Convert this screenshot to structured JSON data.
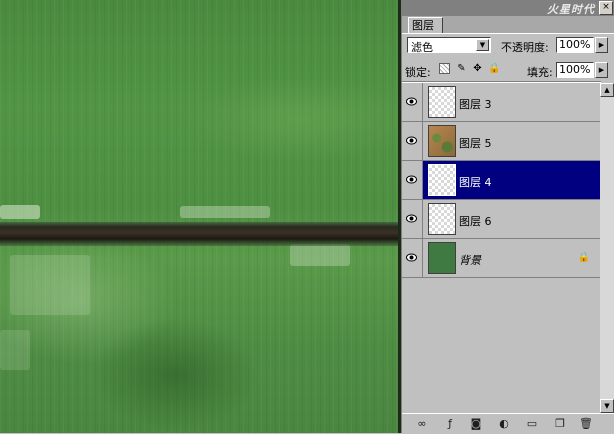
{
  "panel": {
    "watermark": "火星时代",
    "close_glyph": "×",
    "tab_label": "图层",
    "blend_mode": "滤色",
    "opacity_label": "不透明度:",
    "opacity_value": "100%",
    "lock_label": "锁定:",
    "fill_label": "填充:",
    "fill_value": "100%"
  },
  "layers": [
    {
      "name": "图层 3",
      "visible": true,
      "thumb": "transparent"
    },
    {
      "name": "图层 5",
      "visible": true,
      "thumb": "rust"
    },
    {
      "name": "图层 4",
      "visible": true,
      "thumb": "transparent",
      "selected": true
    },
    {
      "name": "图层 6",
      "visible": true,
      "thumb": "transparent"
    },
    {
      "name": "背景",
      "visible": true,
      "thumb": "green",
      "locked": true
    }
  ],
  "footer_icons": [
    "link-layers-icon",
    "layer-style-icon",
    "add-mask-icon",
    "adjustment-layer-icon",
    "new-group-icon",
    "new-layer-icon",
    "delete-layer-icon"
  ],
  "colors": {
    "selection": "#000080",
    "panel_bg": "#c0c0c0",
    "canvas_green": "#4e8f42"
  }
}
